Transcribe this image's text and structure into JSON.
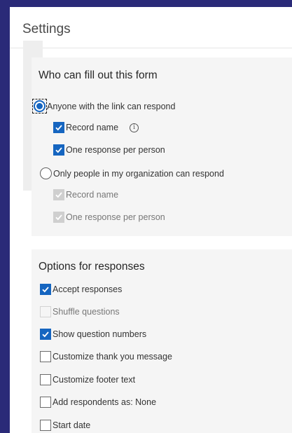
{
  "header": {
    "title": "Settings"
  },
  "who_section": {
    "title": "Who can fill out this form",
    "anyone_option": "Anyone with the link can respond",
    "record_name": "Record name",
    "one_response": "One response per person",
    "org_option": "Only people in my organization can respond",
    "org_record_name": "Record name",
    "org_one_response": "One response per person"
  },
  "options_section": {
    "title": "Options for responses",
    "items": [
      {
        "label": "Accept responses",
        "checked": true,
        "disabled": false
      },
      {
        "label": "Shuffle questions",
        "checked": false,
        "disabled": true
      },
      {
        "label": "Show question numbers",
        "checked": true,
        "disabled": false
      },
      {
        "label": "Customize thank you message",
        "checked": false,
        "disabled": false
      },
      {
        "label": "Customize footer text",
        "checked": false,
        "disabled": false
      },
      {
        "label": "Add respondents as: None",
        "checked": false,
        "disabled": false
      },
      {
        "label": "Start date",
        "checked": false,
        "disabled": false
      }
    ]
  },
  "colors": {
    "accent": "#1565c0",
    "frame": "#2a2a78",
    "section_bg": "#f5f5f5"
  }
}
